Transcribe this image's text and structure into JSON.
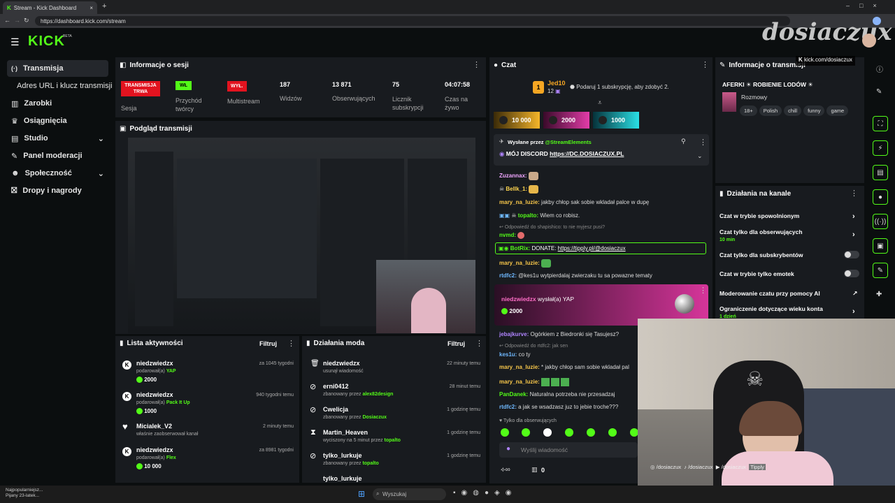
{
  "browser": {
    "tab_title": "Stream - Kick Dashboard",
    "url": "https://dashboard.kick.com/stream"
  },
  "header": {
    "logo": "KICK",
    "beta": "BETA",
    "brand_overlay": "dosiaczux"
  },
  "sidebar": {
    "items": [
      {
        "label": "Transmisja",
        "icon": "broadcast-icon"
      },
      {
        "label": "Adres URL i klucz transmisji"
      },
      {
        "label": "Zarobki",
        "icon": "bar-chart-icon"
      },
      {
        "label": "Osiągnięcia",
        "icon": "trophy-icon"
      },
      {
        "label": "Studio",
        "icon": "studio-icon"
      },
      {
        "label": "Panel moderacji",
        "icon": "wrench-icon"
      },
      {
        "label": "Społeczność",
        "icon": "people-icon"
      },
      {
        "label": "Dropy i nagrody",
        "icon": "gift-icon"
      }
    ]
  },
  "session": {
    "title": "Informacje o sesji",
    "stats": [
      {
        "badge": "TRANSMISJA TRWA",
        "label": "Sesja"
      },
      {
        "badge": "WŁ",
        "label": "Przychód twórcy"
      },
      {
        "badge": "WYŁ.",
        "label": "Multistream"
      },
      {
        "value": "187",
        "label": "Widzów"
      },
      {
        "value": "13 871",
        "label": "Obserwujących"
      },
      {
        "value": "75",
        "label": "Licznik subskrypcji"
      },
      {
        "value": "04:07:58",
        "label": "Czas na żywo"
      }
    ]
  },
  "preview": {
    "title": "Podgląd transmisji"
  },
  "activity": {
    "title": "Lista aktywności",
    "filter": "Filtruj",
    "items": [
      {
        "name": "niedzwiedzx",
        "time": "za 1045 tygodni",
        "action": "podarował(a)",
        "item": "YAP",
        "amount": "2000"
      },
      {
        "name": "niedzwiedzx",
        "time": "940 tygodni temu",
        "action": "podarował(a)",
        "item": "Pack It Up",
        "amount": "1000"
      },
      {
        "name": "Micialek_V2",
        "time": "2 minuty temu",
        "action": "właśnie zaobserwował kanał",
        "item": "",
        "amount": ""
      },
      {
        "name": "niedzwiedzx",
        "time": "za 8981 tygodni",
        "action": "podarował(a)",
        "item": "Flex",
        "amount": "10 000"
      }
    ]
  },
  "modactions": {
    "title": "Działania moda",
    "filter": "Filtruj",
    "items": [
      {
        "name": "niedzwiedzx",
        "time": "22 minuty temu",
        "action": "usunął wiadomość",
        "by": ""
      },
      {
        "name": "erni0412",
        "time": "28 minut temu",
        "action": "zbanowany przez",
        "by": "alex82design"
      },
      {
        "name": "Cwelicja",
        "time": "1 godzinę temu",
        "action": "zbanowany przez",
        "by": "Dosiaczux"
      },
      {
        "name": "Martin_Heaven",
        "time": "1 godzinę temu",
        "action": "wyciszony na 5 minut przez",
        "by": "topalto"
      },
      {
        "name": "tylko_lurkuje",
        "time": "1 godzinę temu",
        "action": "zbanowany przez",
        "by": "topalto"
      },
      {
        "name": "tylko_lurkuje",
        "time": "",
        "action": "",
        "by": ""
      }
    ]
  },
  "chat": {
    "title": "Czat",
    "top_gifter": {
      "name": "Jed10",
      "count": "12"
    },
    "gift_prompt": "Podaruj 1 subskrypcję, aby zdobyć 2.",
    "chips": [
      "10 000",
      "2000",
      "1000"
    ],
    "pinned": {
      "label": "Wysłane przez",
      "by": "@StreamElements",
      "text": "MÓJ DISCORD",
      "link": "https://DC.DOSIACZUX.PL"
    },
    "messages": [
      {
        "user": "Zuzannax:",
        "text": "",
        "color": "#f0a6ff"
      },
      {
        "user": "Bellk_1:",
        "text": "",
        "color": "#ffd54f"
      },
      {
        "user": "mary_na_luzie:",
        "text": "jakby chłop sak sobie wkladał palce w dupę",
        "color": "#f8c74a"
      },
      {
        "user": "topalto:",
        "text": "Wiem co robisz.",
        "color": "#53fc18"
      },
      {
        "reply": "Odpowiedź do shapishico: to nie myjesz pusi?"
      },
      {
        "user": "nvmd:",
        "text": "",
        "color": "#53fc18"
      },
      {
        "user": "BotRix:",
        "text": "DONATE:",
        "link": "https://tippIy.pl/@dosiaczux",
        "color": "#53fc18"
      },
      {
        "user": "mary_na_luzie:",
        "text": "",
        "color": "#f8c74a"
      },
      {
        "user": "rtdfc2:",
        "text": "@kes1u wytpierdalaj zwierzaku tu sa powazne tematy",
        "color": "#6fb8ff"
      }
    ],
    "gift_card": {
      "user": "niedzwiedzx",
      "text": "wysłał(a) YAP",
      "amount": "2000"
    },
    "messages2": [
      {
        "user": "jebajkurve:",
        "text": "Ogórkiem z Biedronki się Tasujesz?",
        "color": "#b084ff"
      },
      {
        "reply": "Odpowiedź do rtdfc2: jak sen"
      },
      {
        "user": "kes1u:",
        "text": "co ty",
        "color": "#6fb8ff"
      },
      {
        "user": "mary_na_luzie:",
        "text": "* jakby chłop sam sobie wkladał pal",
        "color": "#f8c74a"
      },
      {
        "user": "mary_na_luzie:",
        "text": "",
        "color": "#f8c74a"
      },
      {
        "user": "PanDanek:",
        "text": "Naturalna potrzeba nie przesadzaj",
        "color": "#53fc18"
      },
      {
        "user": "rtdfc2:",
        "text": "a jak se wsadzasz juz to jebie troche???",
        "color": "#6fb8ff"
      }
    ],
    "followers_only": "Tylko dla obserwujących",
    "input_placeholder": "Wyślij wiadomość",
    "footer_count": "0"
  },
  "stream_info": {
    "title": "Informacje o transmisji",
    "stream_title": "AFERKI ☀ ROBIENIE LODÓW ☀",
    "category": "Rozmowy",
    "tags": [
      "18+",
      "Polish",
      "chill",
      "funny",
      "game"
    ],
    "url_overlay": "kick.com/dosiaczux"
  },
  "channel_actions": {
    "title": "Działania na kanale",
    "items": [
      {
        "label": "Czat w trybie spowolnionym",
        "sub": ""
      },
      {
        "label": "Czat tylko dla obserwujących",
        "sub": "10 min"
      },
      {
        "label": "Czat tylko dla subskrybentów",
        "sub": ""
      },
      {
        "label": "Czat w trybie tylko emotek",
        "sub": ""
      },
      {
        "label": "Moderowanie czatu przy pomocy AI",
        "sub": ""
      },
      {
        "label": "Ograniczenie dotyczące wieku konta",
        "sub": "1 dzień"
      }
    ]
  },
  "webcam_socials": [
    "/dosiaczux",
    "/dosiaczux",
    "/dosiaczux",
    "Tipply"
  ],
  "taskbar": {
    "news_line1": "Najpopularniejsz...",
    "news_line2": "Pijany 23-latek...",
    "search": "Wyszukaj"
  },
  "colors": {
    "kick_green": "#53fc18",
    "live_red": "#e2131f",
    "panel_bg": "#181b1f"
  }
}
